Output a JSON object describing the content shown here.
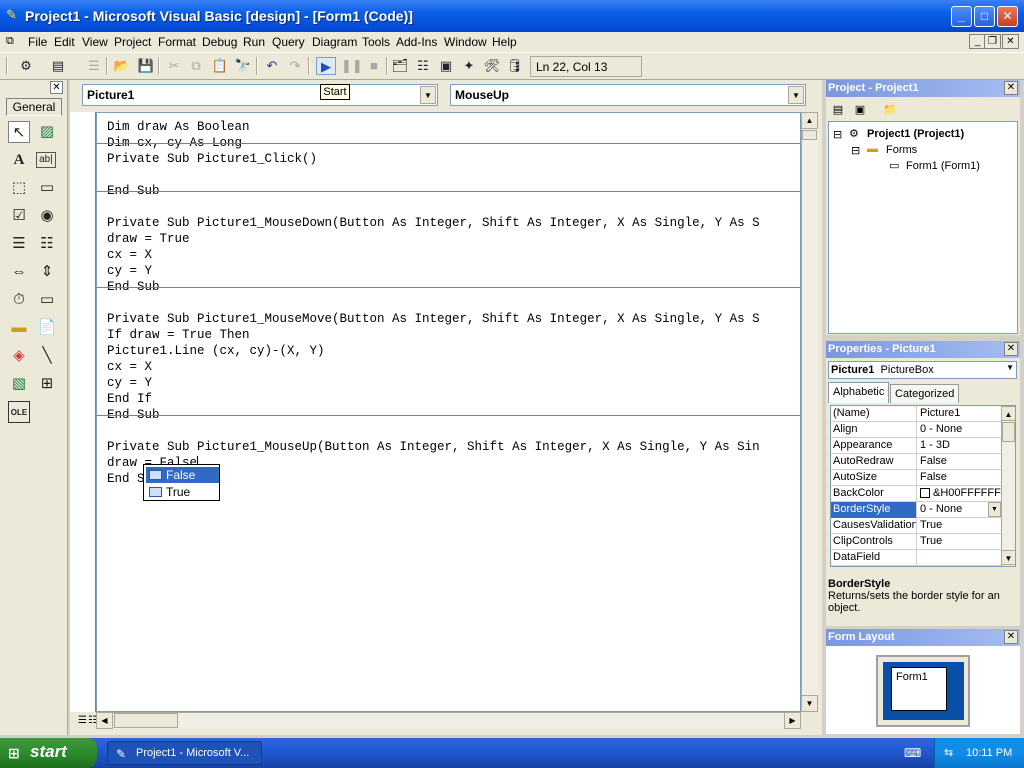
{
  "window": {
    "title": "Project1 - Microsoft Visual Basic [design] - [Form1 (Code)]",
    "minimize": "_",
    "maximize": "□",
    "close": "✕"
  },
  "menu": {
    "items": [
      "File",
      "Edit",
      "View",
      "Project",
      "Format",
      "Debug",
      "Run",
      "Query",
      "Diagram",
      "Tools",
      "Add-Ins",
      "Window",
      "Help"
    ]
  },
  "toolbar": {
    "status": "Ln 22, Col 13"
  },
  "toolbox": {
    "tab": "General"
  },
  "code_window": {
    "object_combo": "Picture1",
    "procedure_combo": "MouseUp",
    "tooltip": "Start",
    "lines": [
      "Dim draw As Boolean",
      "Dim cx, cy As Long",
      "Private Sub Picture1_Click()",
      "",
      "End Sub",
      "",
      "Private Sub Picture1_MouseDown(Button As Integer, Shift As Integer, X As Single, Y As S",
      "draw = True",
      "cx = X",
      "cy = Y",
      "End Sub",
      "",
      "Private Sub Picture1_MouseMove(Button As Integer, Shift As Integer, X As Single, Y As S",
      "If draw = True Then",
      "Picture1.Line (cx, cy)-(X, Y)",
      "cx = X",
      "cy = Y",
      "End If",
      "End Sub",
      "",
      "Private Sub Picture1_MouseUp(Button As Integer, Shift As Integer, X As Single, Y As Sin",
      "draw = False",
      "End S"
    ],
    "autocomplete": [
      "False",
      "True"
    ]
  },
  "project_panel": {
    "title": "Project - Project1",
    "root": "Project1 (Project1)",
    "folder": "Forms",
    "item": "Form1 (Form1)"
  },
  "properties_panel": {
    "title": "Properties - Picture1",
    "object_name": "Picture1",
    "object_type": "PictureBox",
    "tabs": [
      "Alphabetic",
      "Categorized"
    ],
    "rows": [
      {
        "name": "(Name)",
        "value": "Picture1"
      },
      {
        "name": "Align",
        "value": "0 - None"
      },
      {
        "name": "Appearance",
        "value": "1 - 3D"
      },
      {
        "name": "AutoRedraw",
        "value": "False"
      },
      {
        "name": "AutoSize",
        "value": "False"
      },
      {
        "name": "BackColor",
        "value": "&H00FFFFFF"
      },
      {
        "name": "BorderStyle",
        "value": "0 - None"
      },
      {
        "name": "CausesValidation",
        "value": "True"
      },
      {
        "name": "ClipControls",
        "value": "True"
      },
      {
        "name": "DataField",
        "value": ""
      }
    ],
    "desc_title": "BorderStyle",
    "desc_text": "Returns/sets the border style for an object."
  },
  "form_layout_panel": {
    "title": "Form Layout",
    "form_label": "Form1"
  },
  "taskbar": {
    "start": "start",
    "task": "Project1 - Microsoft V...",
    "clock": "10:11 PM"
  },
  "colors": {
    "title_blue": "#0a5fe8",
    "selection": "#316ac5",
    "panel_title": "#7a96df",
    "start_green": "#2e8b2e"
  }
}
